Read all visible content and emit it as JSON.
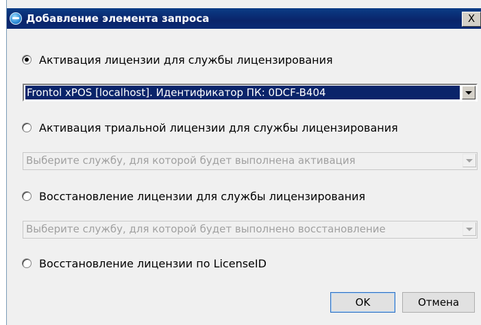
{
  "dialog": {
    "title": "Добавление элемента запроса",
    "close_glyph": "X"
  },
  "options": [
    {
      "label": "Активация лицензии для службы лицензирования",
      "checked": true,
      "combo": {
        "value": "Frontol xPOS [localhost]. Идентификатор ПК: 0DCF-B404",
        "enabled": true
      }
    },
    {
      "label": "Активация триальной лицензии для службы лицензирования",
      "checked": false,
      "combo": {
        "value": "Выберите службу, для которой будет выполнена активация",
        "enabled": false
      }
    },
    {
      "label": "Восстановление лицензии для службы лицензирования",
      "checked": false,
      "combo": {
        "value": "Выберите службу, для которой будет выполнено восстановление",
        "enabled": false
      }
    },
    {
      "label": "Восстановление лицензии по LicenseID",
      "checked": false
    }
  ],
  "buttons": {
    "ok": "OK",
    "cancel": "Отмена"
  },
  "icons": {
    "title": "app-globe-icon",
    "close": "close-icon",
    "dropdown": "chevron-down-icon"
  },
  "colors": {
    "titlebar": "#0a246a",
    "selection": "#0a246a",
    "dialog_bg": "#f0f0f0"
  }
}
